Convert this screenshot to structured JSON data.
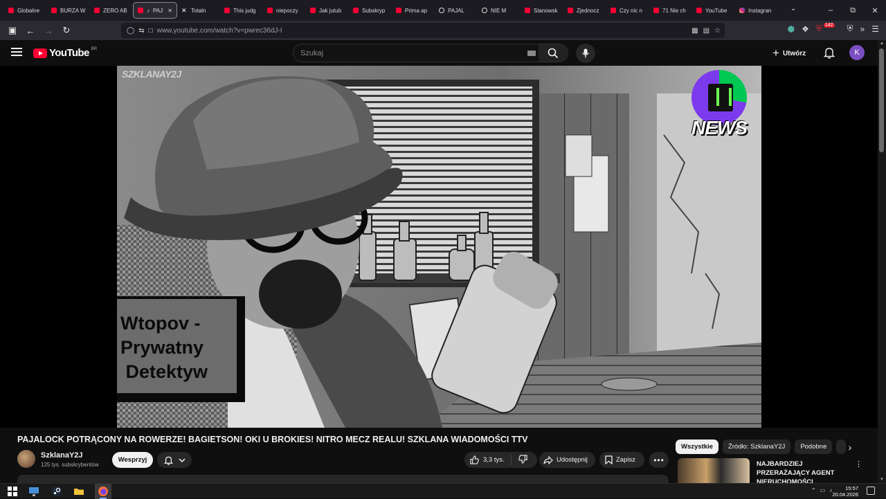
{
  "browser": {
    "tabs": [
      {
        "label": "Globalne",
        "icon": "youtube-icon"
      },
      {
        "label": "BURZA W",
        "icon": "youtube-icon"
      },
      {
        "label": "ZERO AB",
        "icon": "youtube-icon"
      },
      {
        "label": "PAJ",
        "icon": "youtube-icon",
        "active": true
      },
      {
        "label": "Totaln",
        "icon": "x-icon"
      },
      {
        "label": "This judg",
        "icon": "youtube-icon"
      },
      {
        "label": "niepoczy",
        "icon": "youtube-icon"
      },
      {
        "label": "Jak jutub",
        "icon": "youtube-icon"
      },
      {
        "label": "Subskryp",
        "icon": "youtube-icon"
      },
      {
        "label": "Prima ap",
        "icon": "youtube-icon"
      },
      {
        "label": "PAJAL",
        "icon": "play-icon"
      },
      {
        "label": "NIE M",
        "icon": "play-icon"
      },
      {
        "label": "Stanowsk",
        "icon": "youtube-icon"
      },
      {
        "label": "Zjednocz",
        "icon": "youtube-icon"
      },
      {
        "label": "Czy nic n",
        "icon": "youtube-icon"
      },
      {
        "label": "71 Nie ch",
        "icon": "youtube-icon"
      },
      {
        "label": "YouTube",
        "icon": "youtube-icon"
      },
      {
        "label": "Instagran",
        "icon": "instagram-icon"
      }
    ],
    "url": "www.youtube.com/watch?v=pwrec36dJ-I",
    "extension_badge": "142"
  },
  "youtube": {
    "logo_text": "YouTube",
    "logo_country": "BR",
    "search_placeholder": "Szukaj",
    "create_label": "Utwórz",
    "avatar_letter": "K"
  },
  "video": {
    "watermark": "SZKLANAY2J",
    "news_logo_text": "NEWS",
    "caption_lines": [
      "Wtopov -",
      "Prywatny",
      " Detektyw"
    ]
  },
  "details": {
    "title": "PAJALOCK POTRĄCONY NA ROWERZE! BAGIETSON! OKI U BROKIES! NITRO MECZ REALU! SZKLANA WIADOMOŚCI TTV",
    "channel_name": "SzklanaY2J",
    "subscribers": "125 tys. subskrybentów",
    "support_label": "Wesprzyj",
    "likes": "3,3 tys.",
    "share_label": "Udostępnij",
    "save_label": "Zapisz"
  },
  "sidebar": {
    "chips": [
      "Wszystkie",
      "Źródło: SzklanaY2J",
      "Podobne"
    ],
    "recommendation_title": "NAJBARDZIEJ PRZERAŻAJĄCY AGENT NIERUCHOMOŚCI"
  },
  "taskbar": {
    "time": "15:57",
    "date": "20.04.2026"
  },
  "colors": {
    "yt_red": "#ff0033",
    "background": "#0f0f0f",
    "avatar": "#7b4fc2"
  }
}
